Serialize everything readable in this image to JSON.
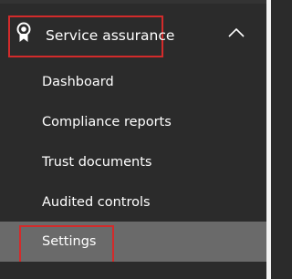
{
  "nav": {
    "group": {
      "label": "Service assurance",
      "icon": "badge-icon",
      "expanded_icon": "chevron-up-icon"
    },
    "items": [
      {
        "label": "Dashboard"
      },
      {
        "label": "Compliance reports"
      },
      {
        "label": "Trust documents"
      },
      {
        "label": "Audited controls"
      },
      {
        "label": "Settings",
        "selected": true
      }
    ]
  },
  "colors": {
    "background": "#2b2b2b",
    "selected_background": "#6a6a6a",
    "text": "#ffffff",
    "highlight": "#d32b2b"
  }
}
